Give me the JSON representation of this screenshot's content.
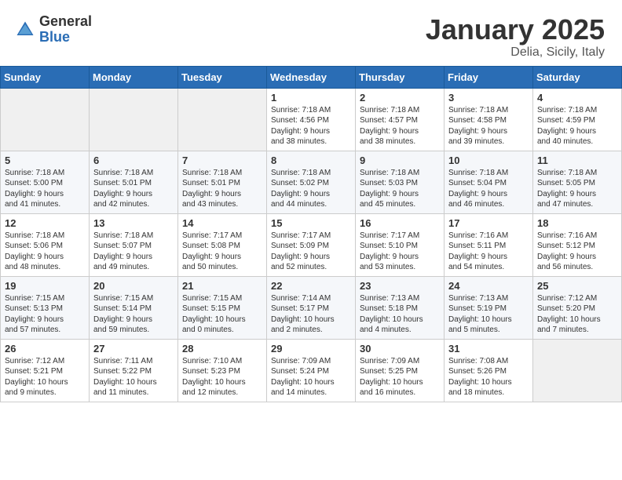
{
  "header": {
    "logo_general": "General",
    "logo_blue": "Blue",
    "month_title": "January 2025",
    "location": "Delia, Sicily, Italy"
  },
  "weekdays": [
    "Sunday",
    "Monday",
    "Tuesday",
    "Wednesday",
    "Thursday",
    "Friday",
    "Saturday"
  ],
  "weeks": [
    [
      {
        "day": "",
        "info": ""
      },
      {
        "day": "",
        "info": ""
      },
      {
        "day": "",
        "info": ""
      },
      {
        "day": "1",
        "info": "Sunrise: 7:18 AM\nSunset: 4:56 PM\nDaylight: 9 hours\nand 38 minutes."
      },
      {
        "day": "2",
        "info": "Sunrise: 7:18 AM\nSunset: 4:57 PM\nDaylight: 9 hours\nand 38 minutes."
      },
      {
        "day": "3",
        "info": "Sunrise: 7:18 AM\nSunset: 4:58 PM\nDaylight: 9 hours\nand 39 minutes."
      },
      {
        "day": "4",
        "info": "Sunrise: 7:18 AM\nSunset: 4:59 PM\nDaylight: 9 hours\nand 40 minutes."
      }
    ],
    [
      {
        "day": "5",
        "info": "Sunrise: 7:18 AM\nSunset: 5:00 PM\nDaylight: 9 hours\nand 41 minutes."
      },
      {
        "day": "6",
        "info": "Sunrise: 7:18 AM\nSunset: 5:01 PM\nDaylight: 9 hours\nand 42 minutes."
      },
      {
        "day": "7",
        "info": "Sunrise: 7:18 AM\nSunset: 5:01 PM\nDaylight: 9 hours\nand 43 minutes."
      },
      {
        "day": "8",
        "info": "Sunrise: 7:18 AM\nSunset: 5:02 PM\nDaylight: 9 hours\nand 44 minutes."
      },
      {
        "day": "9",
        "info": "Sunrise: 7:18 AM\nSunset: 5:03 PM\nDaylight: 9 hours\nand 45 minutes."
      },
      {
        "day": "10",
        "info": "Sunrise: 7:18 AM\nSunset: 5:04 PM\nDaylight: 9 hours\nand 46 minutes."
      },
      {
        "day": "11",
        "info": "Sunrise: 7:18 AM\nSunset: 5:05 PM\nDaylight: 9 hours\nand 47 minutes."
      }
    ],
    [
      {
        "day": "12",
        "info": "Sunrise: 7:18 AM\nSunset: 5:06 PM\nDaylight: 9 hours\nand 48 minutes."
      },
      {
        "day": "13",
        "info": "Sunrise: 7:18 AM\nSunset: 5:07 PM\nDaylight: 9 hours\nand 49 minutes."
      },
      {
        "day": "14",
        "info": "Sunrise: 7:17 AM\nSunset: 5:08 PM\nDaylight: 9 hours\nand 50 minutes."
      },
      {
        "day": "15",
        "info": "Sunrise: 7:17 AM\nSunset: 5:09 PM\nDaylight: 9 hours\nand 52 minutes."
      },
      {
        "day": "16",
        "info": "Sunrise: 7:17 AM\nSunset: 5:10 PM\nDaylight: 9 hours\nand 53 minutes."
      },
      {
        "day": "17",
        "info": "Sunrise: 7:16 AM\nSunset: 5:11 PM\nDaylight: 9 hours\nand 54 minutes."
      },
      {
        "day": "18",
        "info": "Sunrise: 7:16 AM\nSunset: 5:12 PM\nDaylight: 9 hours\nand 56 minutes."
      }
    ],
    [
      {
        "day": "19",
        "info": "Sunrise: 7:15 AM\nSunset: 5:13 PM\nDaylight: 9 hours\nand 57 minutes."
      },
      {
        "day": "20",
        "info": "Sunrise: 7:15 AM\nSunset: 5:14 PM\nDaylight: 9 hours\nand 59 minutes."
      },
      {
        "day": "21",
        "info": "Sunrise: 7:15 AM\nSunset: 5:15 PM\nDaylight: 10 hours\nand 0 minutes."
      },
      {
        "day": "22",
        "info": "Sunrise: 7:14 AM\nSunset: 5:17 PM\nDaylight: 10 hours\nand 2 minutes."
      },
      {
        "day": "23",
        "info": "Sunrise: 7:13 AM\nSunset: 5:18 PM\nDaylight: 10 hours\nand 4 minutes."
      },
      {
        "day": "24",
        "info": "Sunrise: 7:13 AM\nSunset: 5:19 PM\nDaylight: 10 hours\nand 5 minutes."
      },
      {
        "day": "25",
        "info": "Sunrise: 7:12 AM\nSunset: 5:20 PM\nDaylight: 10 hours\nand 7 minutes."
      }
    ],
    [
      {
        "day": "26",
        "info": "Sunrise: 7:12 AM\nSunset: 5:21 PM\nDaylight: 10 hours\nand 9 minutes."
      },
      {
        "day": "27",
        "info": "Sunrise: 7:11 AM\nSunset: 5:22 PM\nDaylight: 10 hours\nand 11 minutes."
      },
      {
        "day": "28",
        "info": "Sunrise: 7:10 AM\nSunset: 5:23 PM\nDaylight: 10 hours\nand 12 minutes."
      },
      {
        "day": "29",
        "info": "Sunrise: 7:09 AM\nSunset: 5:24 PM\nDaylight: 10 hours\nand 14 minutes."
      },
      {
        "day": "30",
        "info": "Sunrise: 7:09 AM\nSunset: 5:25 PM\nDaylight: 10 hours\nand 16 minutes."
      },
      {
        "day": "31",
        "info": "Sunrise: 7:08 AM\nSunset: 5:26 PM\nDaylight: 10 hours\nand 18 minutes."
      },
      {
        "day": "",
        "info": ""
      }
    ]
  ]
}
